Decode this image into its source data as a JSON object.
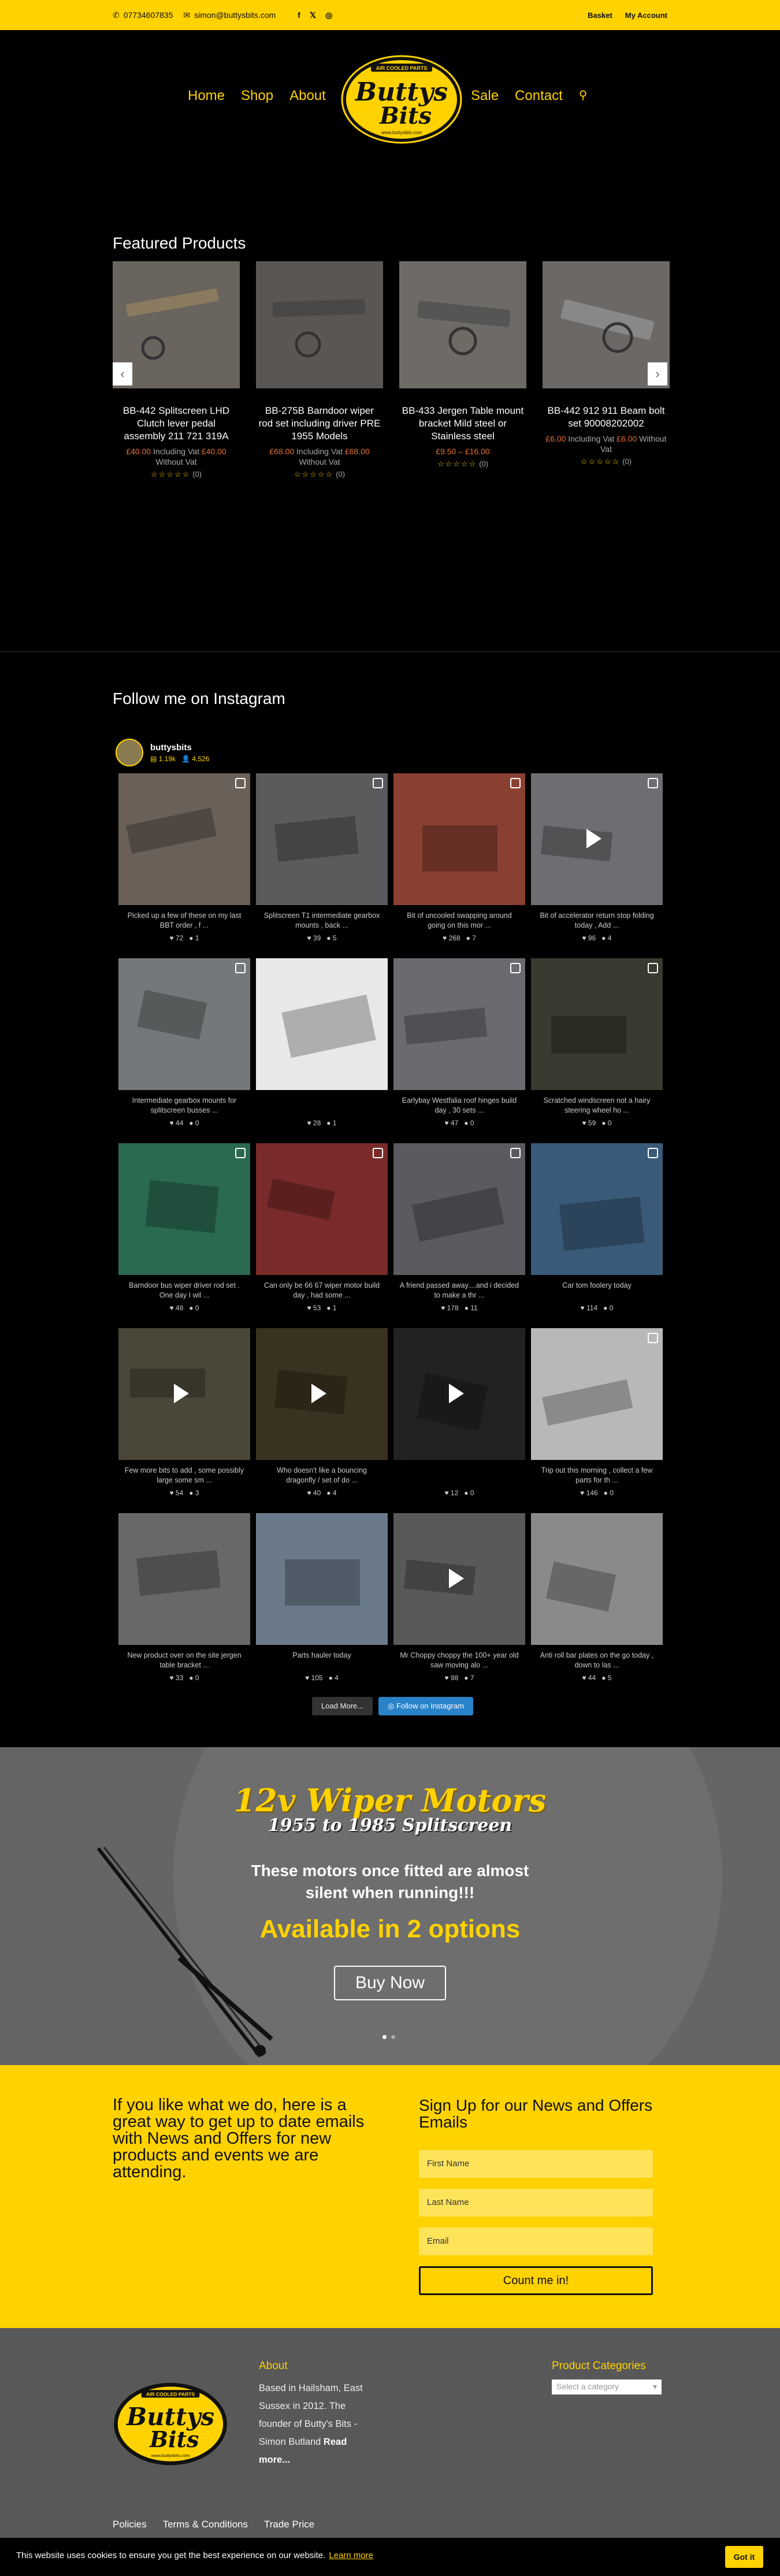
{
  "topbar": {
    "phone": "07734607835",
    "email": "simon@buttysbits.com",
    "social": [
      "f",
      "𝕏",
      "◎"
    ],
    "basket": "Basket",
    "account": "My Account"
  },
  "nav": {
    "left": [
      "Home",
      "Shop",
      "About"
    ],
    "right": [
      "Sale",
      "Contact"
    ],
    "logo_top": "AIR COOLED PARTS",
    "logo_main": "Buttys",
    "logo_sub": "Bits",
    "logo_url": "www.buttysbits.com"
  },
  "featured": {
    "title": "Featured Products",
    "products": [
      {
        "title": "BB-442 Splitscreen LHD Clutch lever pedal assembly 211 721 319A",
        "price": "£40.00",
        "inc": "Including Vat",
        "price2": "£40.00",
        "without": "Without Vat",
        "rating": "(0)"
      },
      {
        "title": "BB-275B Barndoor wiper rod set including driver PRE 1955 Models",
        "price": "£68.00",
        "inc": "Including Vat",
        "price2": "£68.00",
        "without": "Without Vat",
        "rating": "(0)"
      },
      {
        "title": "BB-433 Jergen Table mount bracket Mild steel or Stainless steel",
        "price": "£9.50 – £16.00",
        "inc": "",
        "price2": "",
        "without": "",
        "rating": "(0)"
      },
      {
        "title": "BB-442 912 911 Beam bolt set 90008202002",
        "price": "£6.00",
        "inc": "Including Vat",
        "price2": "£6.00",
        "without": "Without Vat",
        "rating": "(0)"
      }
    ]
  },
  "instagram": {
    "title": "Follow me on Instagram",
    "username": "buttysbits",
    "posts_count": "1.19k",
    "followers": "4,526",
    "posts": [
      {
        "caption": "Picked up a few of these on my last BBT order , f ...",
        "likes": "72",
        "comments": "1"
      },
      {
        "caption": "Splitscreen T1 intermediate gearbox mounts , back ...",
        "likes": "39",
        "comments": "5"
      },
      {
        "caption": "Bit of uncooled swapping around going on this mor ...",
        "likes": "268",
        "comments": "7"
      },
      {
        "caption": "Bit of accelerator return stop folding today , Add ...",
        "likes": "96",
        "comments": "4"
      },
      {
        "caption": "Intermediate gearbox mounts for splitscreen busses ...",
        "likes": "44",
        "comments": "0"
      },
      {
        "caption": "",
        "likes": "28",
        "comments": "1"
      },
      {
        "caption": "Earlybay Westfalia roof hinges build day , 30 sets ...",
        "likes": "47",
        "comments": "0"
      },
      {
        "caption": "Scratched windscreen not a hairy steering wheel ho ...",
        "likes": "59",
        "comments": "0"
      },
      {
        "caption": "Barndoor bus wiper driver rod set . One day I wil ...",
        "likes": "48",
        "comments": "0"
      },
      {
        "caption": "Can only be 66 67 wiper motor build day , had some ...",
        "likes": "53",
        "comments": "1"
      },
      {
        "caption": "A friend passed away....and i decided to make a thr ...",
        "likes": "178",
        "comments": "11"
      },
      {
        "caption": "Car tom foolery today",
        "likes": "114",
        "comments": "0"
      },
      {
        "caption": "Few more bits to add , some possibly large some sm ...",
        "likes": "54",
        "comments": "3"
      },
      {
        "caption": "Who doesn't like a bouncing dragonfly / set of do ...",
        "likes": "40",
        "comments": "4"
      },
      {
        "caption": "",
        "likes": "12",
        "comments": "0"
      },
      {
        "caption": "Trip out this morning , collect a few parts for th ...",
        "likes": "146",
        "comments": "0"
      },
      {
        "caption": "New product over on the site jergen table bracket ...",
        "likes": "33",
        "comments": "0"
      },
      {
        "caption": "Parts hauler today",
        "likes": "105",
        "comments": "4"
      },
      {
        "caption": "Mr Choppy choppy the 100+ year old saw moving alo ...",
        "likes": "98",
        "comments": "7"
      },
      {
        "caption": "Anti roll bar plates on the go today , down to las ...",
        "likes": "44",
        "comments": "5"
      }
    ],
    "load_more": "Load More...",
    "follow": "Follow on Instagram"
  },
  "banner": {
    "title": "12v Wiper Motors",
    "subtitle": "1955 to 1985 Splitscreen",
    "text": "These motors once fitted are almost silent when running!!!",
    "options": "Available in 2 options",
    "button": "Buy Now"
  },
  "signup": {
    "left": "If you like what we do, here is a great way to get up to date emails with News and Offers for new products and events we are attending.",
    "title": "Sign Up for our News and Offers Emails",
    "first": "First Name",
    "last": "Last Name",
    "email": "Email",
    "button": "Count me in!"
  },
  "footer": {
    "about_title": "About",
    "about_text": "Based in Hailsham, East Sussex in 2012. The founder of Butty's Bits - Simon Butland",
    "read_more": "Read more...",
    "cat_title": "Product Categories",
    "cat_placeholder": "Select a category",
    "links": [
      "Policies",
      "Terms & Conditions",
      "Trade Price"
    ]
  },
  "cookie": {
    "text": "This website uses cookies to ensure you get the best experience on our website.",
    "learn": "Learn more",
    "button": "Got it"
  },
  "colors": {
    "accent": "#ffd200",
    "bg": "#000000",
    "price": "#e07030",
    "follow": "#2a82c9"
  }
}
